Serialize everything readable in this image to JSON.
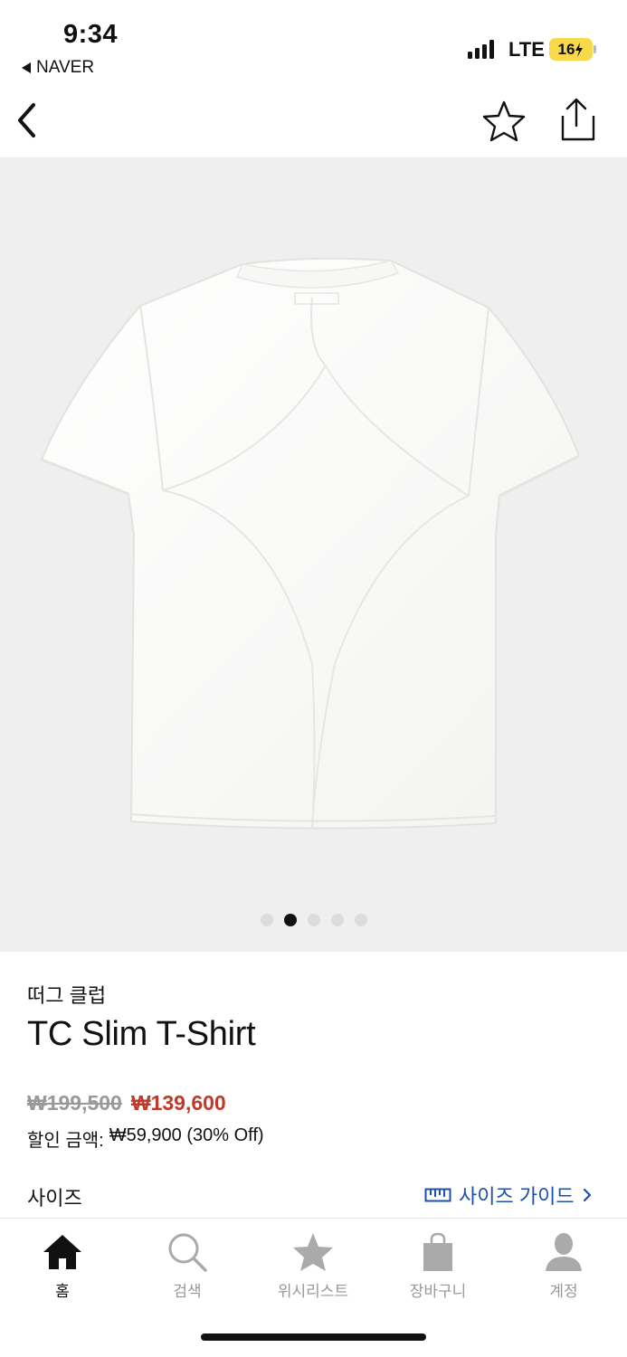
{
  "status_bar": {
    "time": "9:34",
    "back_app": "NAVER",
    "network": "LTE",
    "battery": "16"
  },
  "nav": {
    "back_icon": "chevron-left-icon",
    "favorite_icon": "star-outline-icon",
    "share_icon": "share-icon"
  },
  "gallery": {
    "image": "white-t-shirt-back-view",
    "page_count": 5,
    "active_index": 1
  },
  "product": {
    "brand": "떠그 클럽",
    "name": "TC Slim T-Shirt",
    "original_price": "₩199,500",
    "sale_price": "₩139,600",
    "discount_label": "할인 금액:",
    "discount_value": "₩59,900 (30% Off)"
  },
  "size": {
    "label": "사이즈",
    "guide_label": "사이즈 가이드",
    "guide_icon": "ruler-icon"
  },
  "tab_bar": {
    "items": [
      {
        "label": "홈",
        "icon": "home-icon",
        "active": true
      },
      {
        "label": "검색",
        "icon": "search-icon",
        "active": false
      },
      {
        "label": "위시리스트",
        "icon": "star-icon",
        "active": false
      },
      {
        "label": "장바구니",
        "icon": "shopping-bag-icon",
        "active": false
      },
      {
        "label": "계정",
        "icon": "person-icon",
        "active": false
      }
    ]
  },
  "colors": {
    "sale_red": "#c0392b",
    "link_blue": "#1f4fa8",
    "gallery_bg": "#efefef",
    "battery_yellow": "#f7d94a"
  }
}
